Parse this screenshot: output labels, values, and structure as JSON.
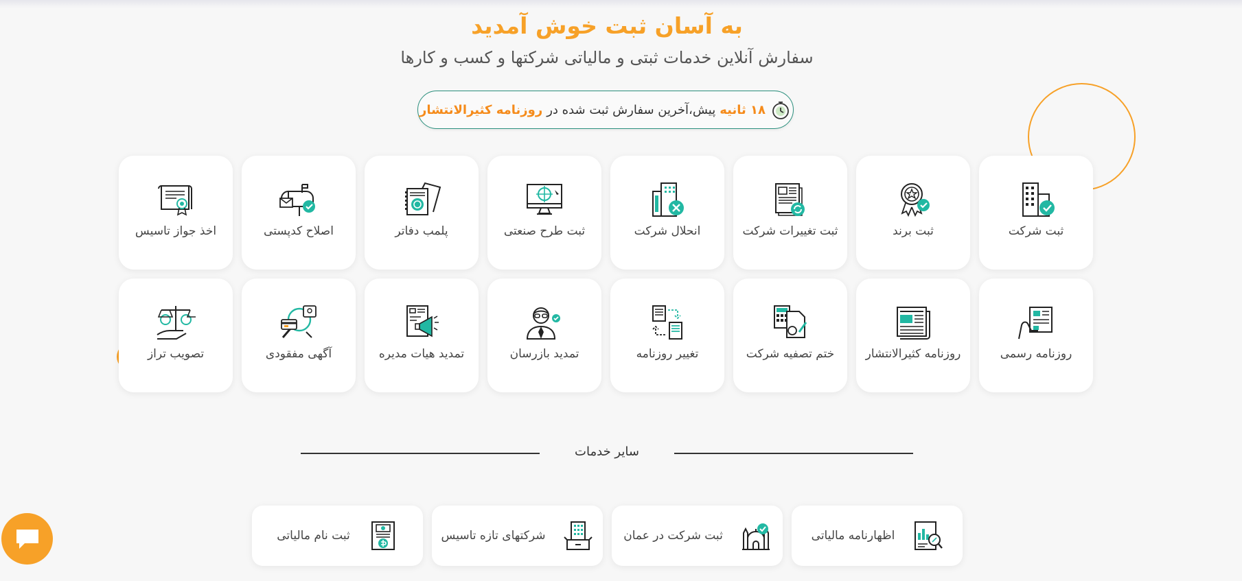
{
  "hero": {
    "title": "به آسان ثبت خوش آمدید",
    "subtitle": "سفارش آنلاین خدمات ثبتی و مالیاتی شرکتها و کسب و کارها"
  },
  "last_order": {
    "time": "۱۸ ثانیه",
    "text": "پیش،آخرین سفارش ثبت شده در",
    "service": "روزنامه کثیرالانتشار"
  },
  "services": [
    {
      "label": "ثبت شرکت",
      "icon": "building-check-icon"
    },
    {
      "label": "ثبت برند",
      "icon": "award-badge-icon"
    },
    {
      "label": "ثبت تغییرات شرکت",
      "icon": "newspaper-refresh-icon"
    },
    {
      "label": "انحلال شرکت",
      "icon": "building-close-icon"
    },
    {
      "label": "ثبت طرح صنعتی",
      "icon": "monitor-design-icon"
    },
    {
      "label": "پلمب دفاتر",
      "icon": "ledger-books-icon"
    },
    {
      "label": "اصلاح کدپستی",
      "icon": "mailbox-icon"
    },
    {
      "label": "اخذ جواز تاسیس",
      "icon": "certificate-icon"
    },
    {
      "label": "روزنامه رسمی",
      "icon": "hand-newspaper-icon"
    },
    {
      "label": "روزنامه کثیرالانتشار",
      "icon": "newspaper-icon"
    },
    {
      "label": "ختم تصفیه شرکت",
      "icon": "calculator-document-icon"
    },
    {
      "label": "تغییر روزنامه",
      "icon": "swap-documents-icon"
    },
    {
      "label": "تمدید بازرسان",
      "icon": "inspector-person-icon"
    },
    {
      "label": "تمدید هیات مدیره",
      "icon": "megaphone-document-icon"
    },
    {
      "label": "آگهی مفقودی",
      "icon": "lost-card-search-icon"
    },
    {
      "label": "تصویب تراز",
      "icon": "balance-scale-icon"
    }
  ],
  "other_services": {
    "title": "سایر خدمات",
    "items": [
      {
        "label": "اظهارنامه مالیاتی",
        "icon": "tax-declaration-icon"
      },
      {
        "label": "ثبت شرکت در عمان",
        "icon": "mosque-check-icon"
      },
      {
        "label": "شرکتهای تازه تاسیس",
        "icon": "new-company-box-icon"
      },
      {
        "label": "ثبت نام مالیاتی",
        "icon": "tax-register-icon"
      }
    ]
  },
  "colors": {
    "accent": "#f7a128",
    "teal": "#22b8a3",
    "border_green": "#2a8f7d",
    "text": "#444444"
  },
  "chat_icon": "chat-bubble-icon"
}
